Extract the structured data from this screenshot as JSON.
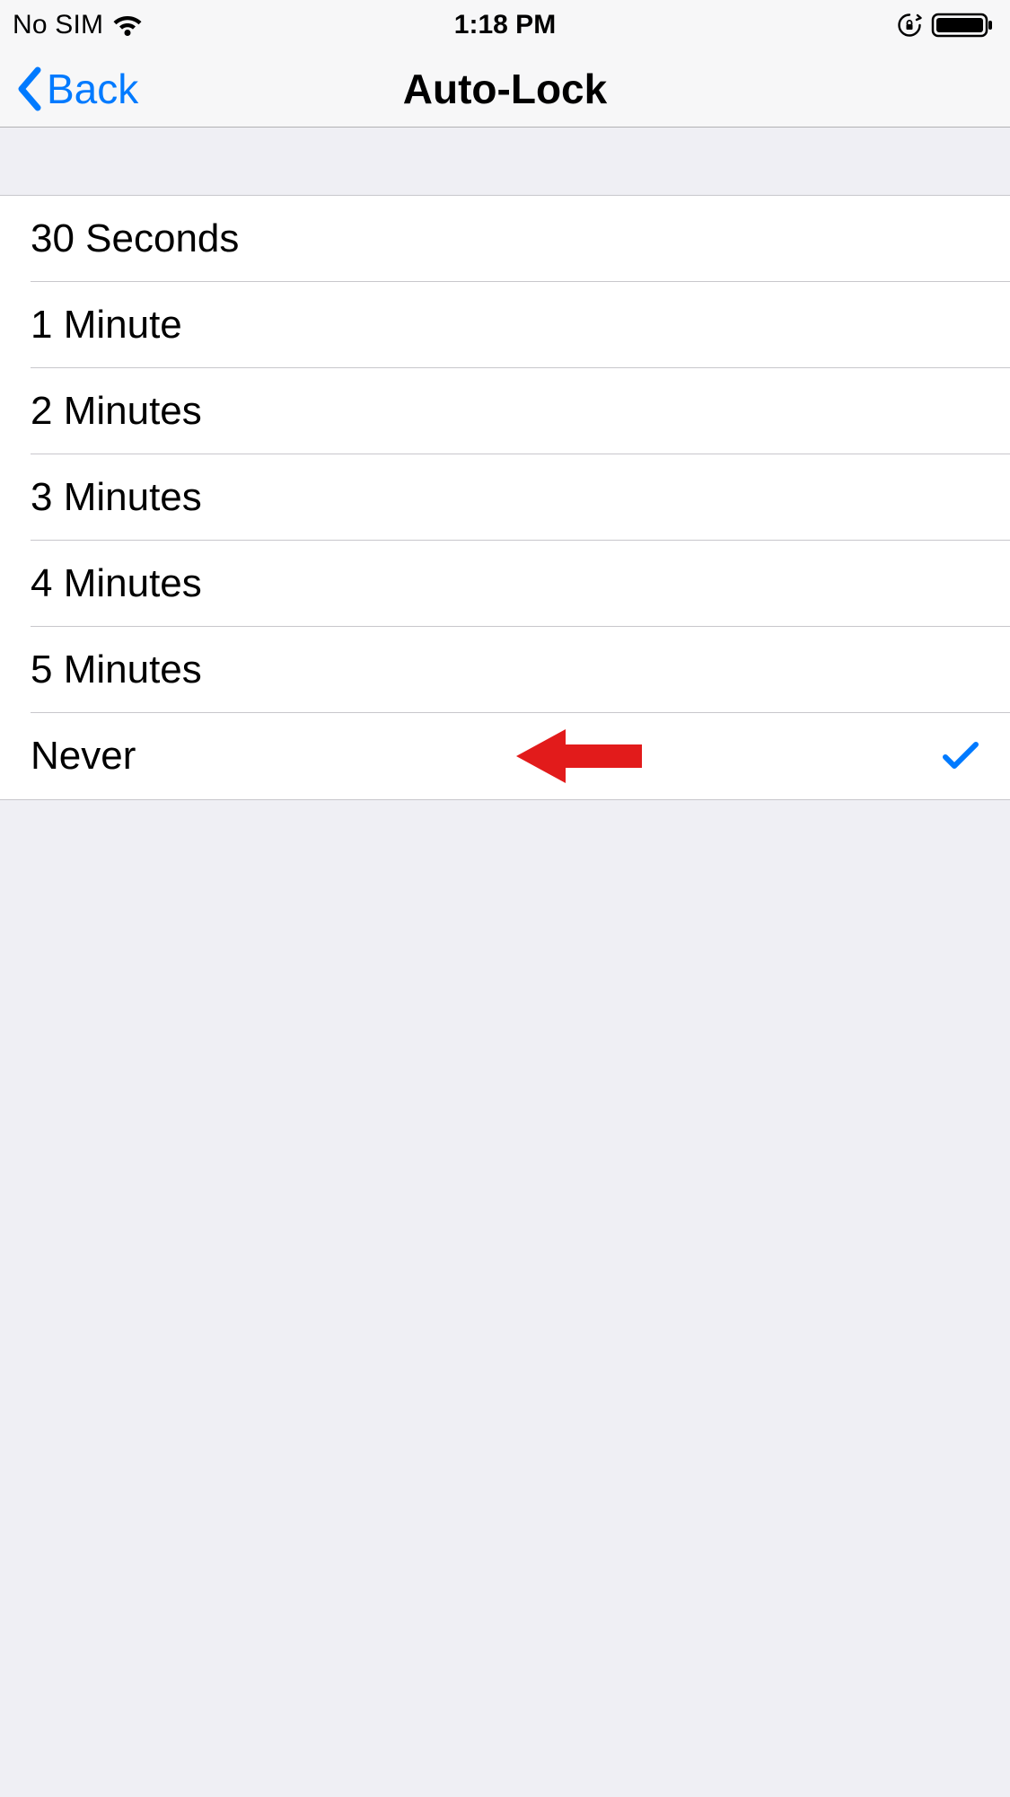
{
  "status_bar": {
    "carrier": "No SIM",
    "time": "1:18 PM"
  },
  "nav": {
    "back_label": "Back",
    "title": "Auto-Lock"
  },
  "options": [
    {
      "label": "30 Seconds",
      "selected": false
    },
    {
      "label": "1 Minute",
      "selected": false
    },
    {
      "label": "2 Minutes",
      "selected": false
    },
    {
      "label": "3 Minutes",
      "selected": false
    },
    {
      "label": "4 Minutes",
      "selected": false
    },
    {
      "label": "5 Minutes",
      "selected": false
    },
    {
      "label": "Never",
      "selected": true
    }
  ],
  "annotation": {
    "arrow_color": "#e21b1b"
  }
}
